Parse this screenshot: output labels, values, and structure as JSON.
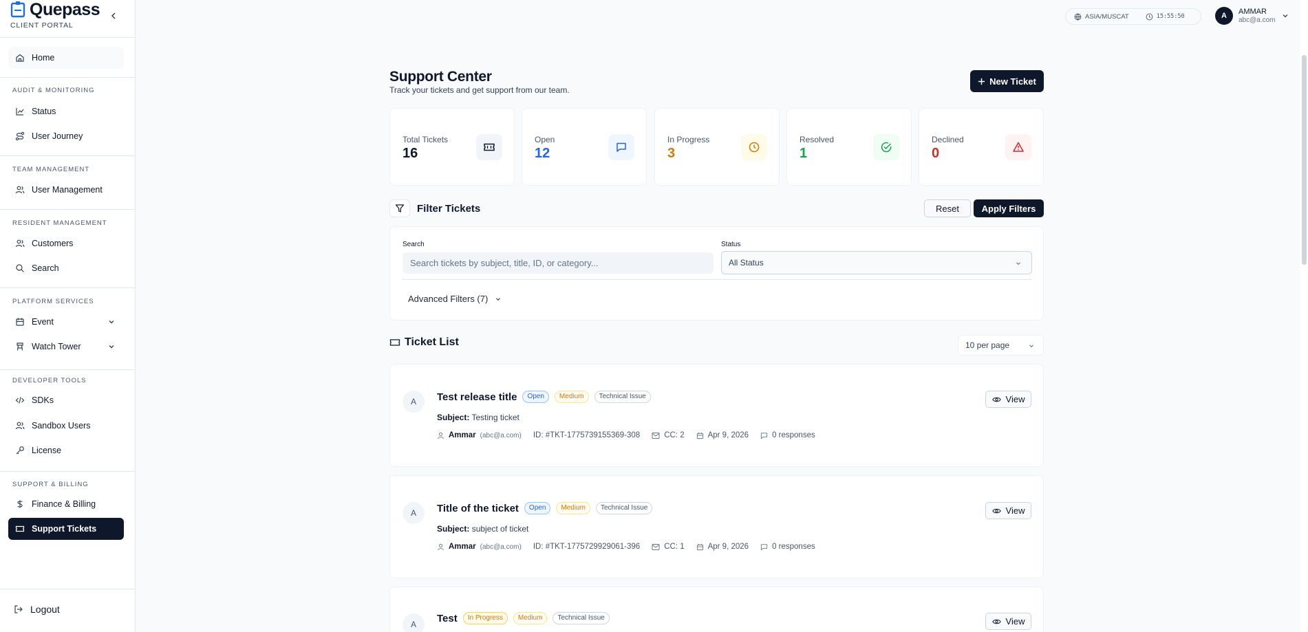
{
  "brand": {
    "name": "Quepass",
    "sub": "CLIENT PORTAL"
  },
  "nav": {
    "home": "Home",
    "sections": {
      "audit": "AUDIT & MONITORING",
      "team": "TEAM MANAGEMENT",
      "resident": "RESIDENT MANAGEMENT",
      "platform": "PLATFORM SERVICES",
      "developer": "DEVELOPER TOOLS",
      "support": "SUPPORT & BILLING"
    },
    "status": "Status",
    "user_journey": "User Journey",
    "user_management": "User Management",
    "customers": "Customers",
    "search": "Search",
    "event": "Event",
    "watch_tower": "Watch Tower",
    "sdks": "SDKs",
    "sandbox_users": "Sandbox Users",
    "license": "License",
    "finance": "Finance & Billing",
    "support_tickets": "Support Tickets",
    "logout": "Logout"
  },
  "topbar": {
    "timezone": "ASIA/MUSCAT",
    "clock": "15:55:50",
    "user_initial": "A",
    "user_name": "AMMAR",
    "user_email": "abc@a.com"
  },
  "page": {
    "title": "Support Center",
    "subtitle": "Track your tickets and get support from our team.",
    "new_ticket": "New Ticket"
  },
  "stats": {
    "total": {
      "label": "Total Tickets",
      "value": "16"
    },
    "open": {
      "label": "Open",
      "value": "12"
    },
    "progress": {
      "label": "In Progress",
      "value": "3"
    },
    "resolved": {
      "label": "Resolved",
      "value": "1"
    },
    "declined": {
      "label": "Declined",
      "value": "0"
    }
  },
  "colors": {
    "open": "#2563eb",
    "progress": "#d97706",
    "resolved": "#16a34a",
    "declined": "#dc2626",
    "dark": "#0f172a"
  },
  "filters": {
    "title": "Filter Tickets",
    "reset": "Reset",
    "apply": "Apply Filters",
    "search_label": "Search",
    "search_placeholder": "Search tickets by subject, title, ID, or category...",
    "status_label": "Status",
    "status_value": "All Status",
    "advanced": "Advanced Filters (7)"
  },
  "list": {
    "title": "Ticket List",
    "per_page": "10 per page"
  },
  "tickets": [
    {
      "initial": "A",
      "title": "Test release title",
      "status": "Open",
      "priority": "Medium",
      "category": "Technical Issue",
      "subject_label": "Subject:",
      "subject": "Testing ticket",
      "user": "Ammar",
      "email": "(abc@a.com)",
      "id": "ID:  #TKT-1775739155369-308",
      "cc": "CC: 2",
      "date": "Apr 9, 2026",
      "responses": "0 responses",
      "view": "View"
    },
    {
      "initial": "A",
      "title": "Title of the ticket",
      "status": "Open",
      "priority": "Medium",
      "category": "Technical Issue",
      "subject_label": "Subject:",
      "subject": "subject of ticket",
      "user": "Ammar",
      "email": "(abc@a.com)",
      "id": "ID:  #TKT-1775729929061-396",
      "cc": "CC: 1",
      "date": "Apr 9, 2026",
      "responses": "0 responses",
      "view": "View"
    },
    {
      "initial": "A",
      "title": "Test",
      "status": "In Progress",
      "priority": "Medium",
      "category": "Technical Issue",
      "view": "View"
    }
  ]
}
